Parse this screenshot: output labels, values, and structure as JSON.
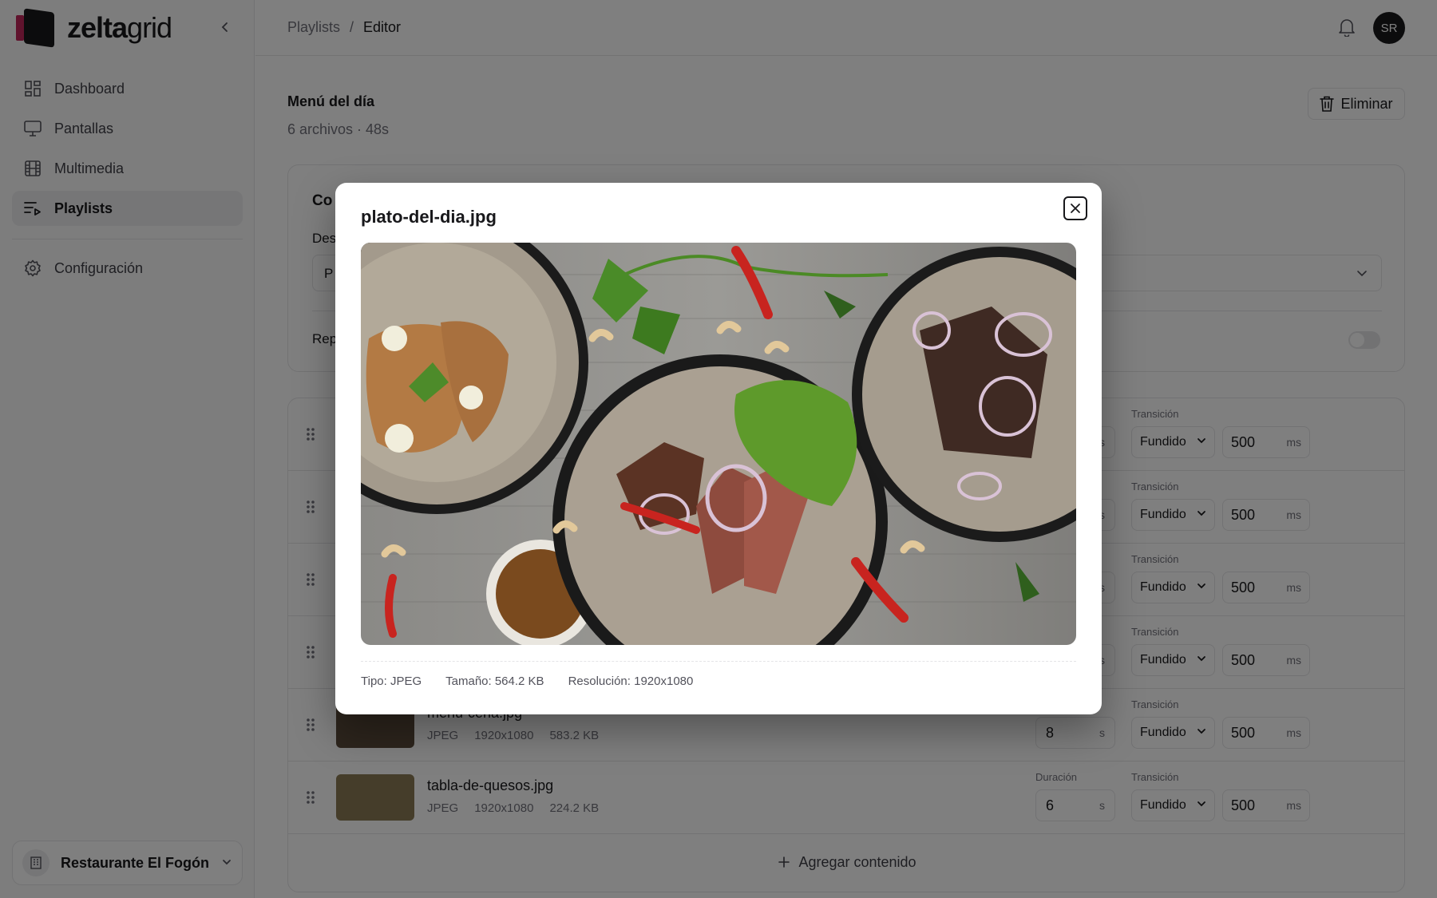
{
  "brand": {
    "name_bold": "zelta",
    "name_light": "grid"
  },
  "nav": {
    "items": [
      {
        "label": "Dashboard",
        "icon": "grid-icon",
        "active": false
      },
      {
        "label": "Pantallas",
        "icon": "monitor-icon",
        "active": false
      },
      {
        "label": "Multimedia",
        "icon": "film-icon",
        "active": false
      },
      {
        "label": "Playlists",
        "icon": "playlist-icon",
        "active": true
      }
    ],
    "settings_label": "Configuración"
  },
  "org": {
    "name": "Restaurante El Fogón"
  },
  "breadcrumb": {
    "parent": "Playlists",
    "separator": "/",
    "current": "Editor"
  },
  "user": {
    "initials": "SR"
  },
  "playlist": {
    "title": "Menú del día",
    "subtitle": "6 archivos · 48s",
    "delete_label": "Eliminar"
  },
  "config": {
    "title_visible": "Co",
    "desc_label_visible": "Des",
    "select_value_visible": "P",
    "loop_label_visible": "Rep"
  },
  "items_common": {
    "duration_label": "Duración",
    "transition_label": "Transición",
    "transition_value": "Fundido",
    "transition_ms": "500",
    "seconds_unit": "s",
    "ms_unit": "ms"
  },
  "items": [
    {
      "name": "",
      "type": "",
      "resolution": "",
      "size": "",
      "duration": ""
    },
    {
      "name": "",
      "type": "",
      "resolution": "",
      "size": "",
      "duration": ""
    },
    {
      "name": "",
      "type": "",
      "resolution": "",
      "size": "",
      "duration": ""
    },
    {
      "name": "",
      "type": "",
      "resolution": "",
      "size": "",
      "duration": ""
    },
    {
      "name": "menu-cena.jpg",
      "type": "JPEG",
      "resolution": "1920x1080",
      "size": "583.2 KB",
      "duration": "8"
    },
    {
      "name": "tabla-de-quesos.jpg",
      "type": "JPEG",
      "resolution": "1920x1080",
      "size": "224.2 KB",
      "duration": "6"
    }
  ],
  "add_content_label": "Agregar contenido",
  "modal": {
    "title": "plato-del-dia.jpg",
    "type": "Tipo: JPEG",
    "size": "Tamaño: 564.2 KB",
    "resolution": "Resolución: 1920x1080"
  },
  "colors": {
    "accent": "#18181b",
    "brand_pink": "#c0265a",
    "border": "#e4e4e7"
  }
}
